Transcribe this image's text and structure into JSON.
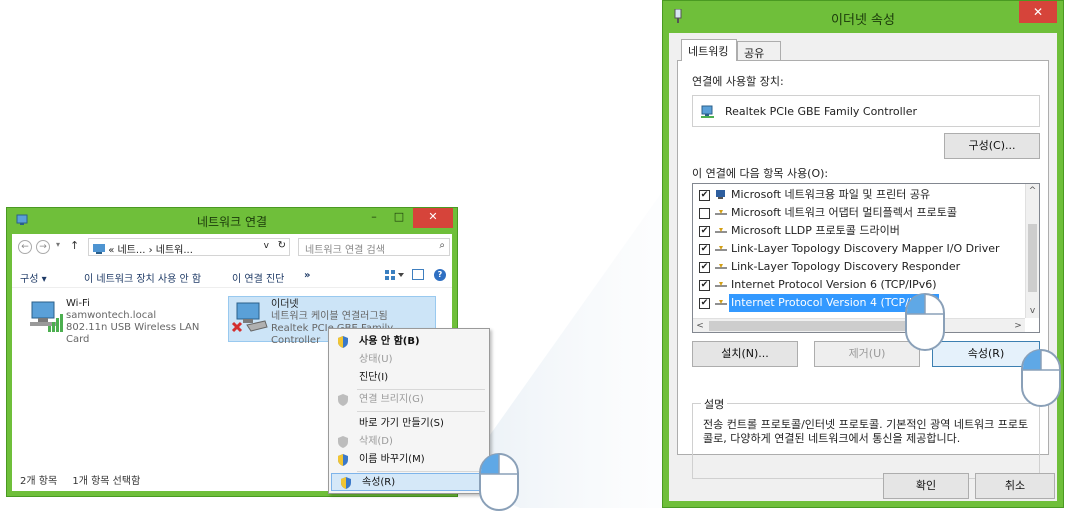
{
  "net_window": {
    "title": "네트워크 연결",
    "win_buttons": {
      "minimize": "–",
      "maximize": "□",
      "close": "✕"
    },
    "nav": {
      "back": "←",
      "forward": "→",
      "dropdown": "▾",
      "up": "↑"
    },
    "breadcrumb": {
      "text": "« 네트... › 네트워...",
      "dropdown": "v",
      "refresh": "↻"
    },
    "search": {
      "placeholder": "네트워크 연결 검색",
      "icon": "⌕"
    },
    "commands": {
      "organize": "구성 ▾",
      "disable": "이 네트워크 장치 사용 안 함",
      "diagnose": "이 연결 진단",
      "more": "»"
    },
    "connections": [
      {
        "name": "Wi-Fi",
        "line1": "samwontech.local",
        "line2": "802.11n USB Wireless LAN Card"
      },
      {
        "name": "이더넷",
        "line1": "네트워크 케이블 연결러그됨",
        "line2": "Realtek PCIe GBE Family Controller"
      }
    ],
    "status": {
      "count": "2개 항목",
      "selected": "1개 항목 선택함"
    }
  },
  "context_menu": {
    "items": [
      {
        "label": "사용 안 함(B)",
        "disabled": false,
        "bold": true,
        "shield": true
      },
      {
        "label": "상태(U)",
        "disabled": true,
        "bold": false,
        "shield": false
      },
      {
        "label": "진단(I)",
        "disabled": false,
        "bold": false,
        "shield": false
      },
      {
        "label": "연결 브리지(G)",
        "disabled": true,
        "bold": false,
        "shield": true
      },
      {
        "label": "바로 가기 만들기(S)",
        "disabled": false,
        "bold": false,
        "shield": false
      },
      {
        "label": "삭제(D)",
        "disabled": true,
        "bold": false,
        "shield": true
      },
      {
        "label": "이름 바꾸기(M)",
        "disabled": false,
        "bold": false,
        "shield": true
      },
      {
        "label": "속성(R)",
        "disabled": false,
        "bold": false,
        "shield": true,
        "highlighted": true
      }
    ]
  },
  "prop_window": {
    "title": "이더넷 속성",
    "close": "✕",
    "tabs": [
      "네트워킹",
      "공유"
    ],
    "connect_using_label": "연결에 사용할 장치:",
    "adapter_name": "Realtek PCIe GBE Family Controller",
    "configure_button": "구성(C)...",
    "items_label": "이 연결에 다음 항목 사용(O):",
    "items": [
      {
        "label": "Microsoft 네트워크용 파일 및 프린터 공유",
        "checked": true
      },
      {
        "label": "Microsoft 네트워크 어댑터 멀티플렉서 프로토콜",
        "checked": false
      },
      {
        "label": "Microsoft LLDP 프로토콜 드라이버",
        "checked": true
      },
      {
        "label": "Link-Layer Topology Discovery Mapper I/O Driver",
        "checked": true
      },
      {
        "label": "Link-Layer Topology Discovery Responder",
        "checked": true
      },
      {
        "label": "Internet Protocol Version 6 (TCP/IPv6)",
        "checked": true
      },
      {
        "label": "Internet Protocol Version 4 (TCP/IPv4)",
        "checked": true,
        "selected": true
      }
    ],
    "scroll": {
      "up": "^",
      "down": "v",
      "left": "<",
      "right": ">"
    },
    "install_button": "설치(N)...",
    "uninstall_button": "제거(U)",
    "properties_button": "속성(R)",
    "description_label": "설명",
    "description_text": "전송 컨트롤 프로토콜/인터넷 프로토콜. 기본적인 광역 네트워크 프로토콜로, 다양하게 연결된 네트워크에서 통신을 제공합니다.",
    "ok_button": "확인",
    "cancel_button": "취소"
  },
  "colors": {
    "window_accent": "#6fbf3a",
    "close_red": "#d6443a",
    "selection": "#3399ff",
    "menu_highlight": "#d5e8f8"
  }
}
